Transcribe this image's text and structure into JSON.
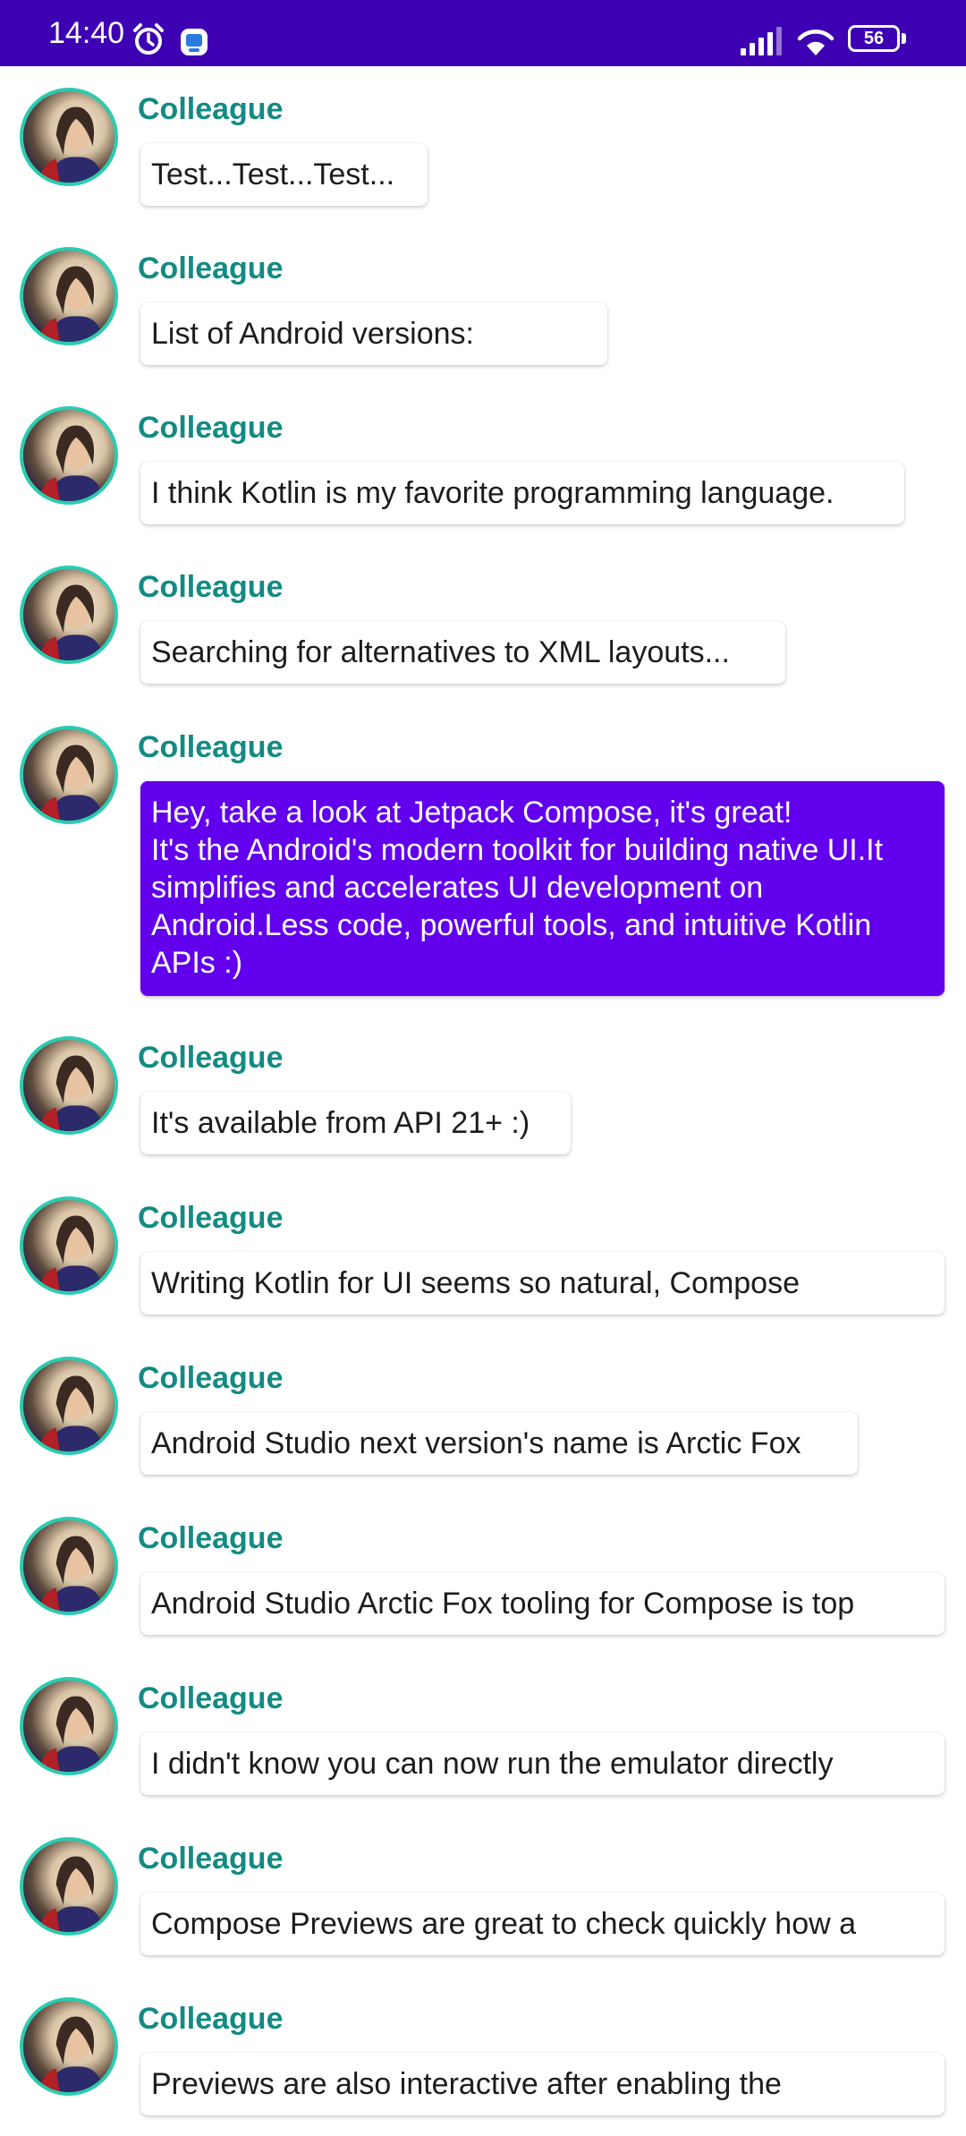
{
  "status_bar": {
    "time": "14:40",
    "battery": "56"
  },
  "messages": [
    {
      "author": "Colleague",
      "body": "Test...Test...Test..."
    },
    {
      "author": "Colleague",
      "body": "List of Android versions:"
    },
    {
      "author": "Colleague",
      "body": "I think Kotlin is my favorite programming language."
    },
    {
      "author": "Colleague",
      "body": "Searching for alternatives to XML layouts..."
    },
    {
      "author": "Colleague",
      "body": "Hey, take a look at Jetpack Compose, it's great!\nIt's the Android's modern toolkit for building native UI.It simplifies and accelerates UI development on Android.Less code, powerful tools, and intuitive Kotlin APIs :)"
    },
    {
      "author": "Colleague",
      "body": "It's available from API 21+ :)"
    },
    {
      "author": "Colleague",
      "body": "Writing Kotlin for UI seems so natural, Compose"
    },
    {
      "author": "Colleague",
      "body": "Android Studio next version's name is Arctic Fox"
    },
    {
      "author": "Colleague",
      "body": "Android Studio Arctic Fox tooling for Compose is top"
    },
    {
      "author": "Colleague",
      "body": "I didn't know you can now run the emulator directly"
    },
    {
      "author": "Colleague",
      "body": "Compose Previews are great to check quickly how a"
    },
    {
      "author": "Colleague",
      "body": "Previews are also interactive after enabling the"
    }
  ],
  "theme": {
    "status_bar_color": "#3d00b3",
    "author_color": "#128b84",
    "expanded_bubble_color": "#6200ee",
    "avatar_ring_color": "#2bcbb0"
  }
}
